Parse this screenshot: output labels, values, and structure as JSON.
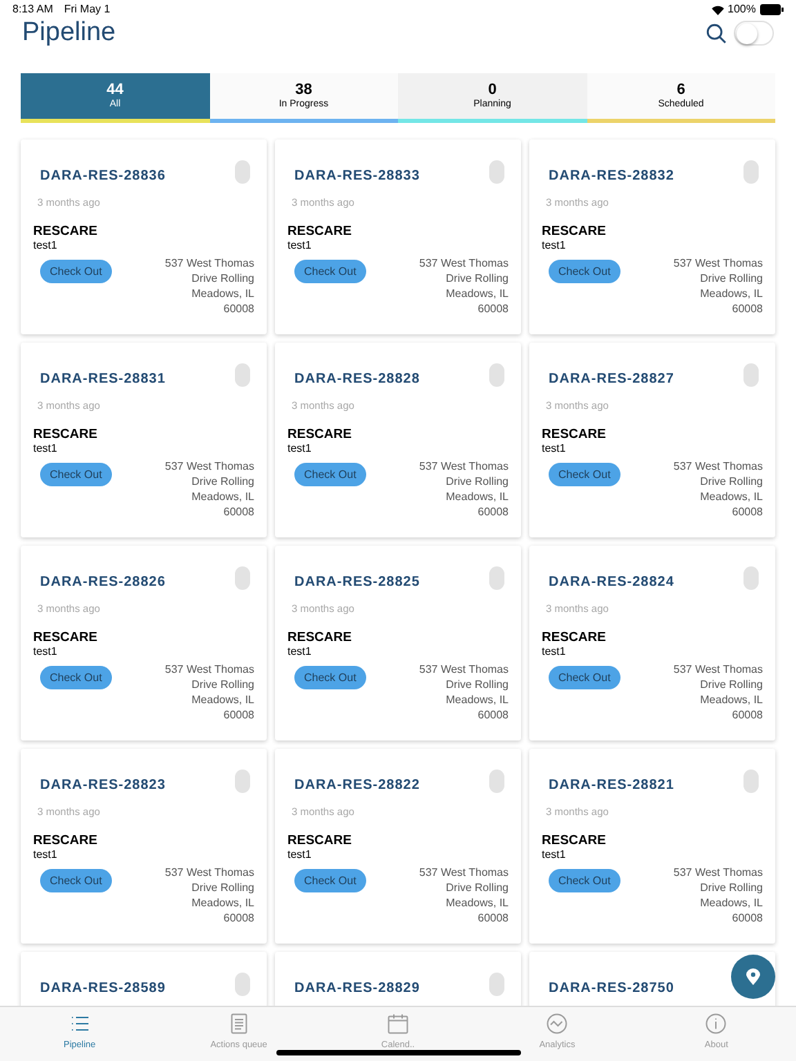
{
  "status_bar": {
    "time": "8:13 AM",
    "date": "Fri May 1",
    "battery": "100%"
  },
  "header": {
    "title": "Pipeline",
    "toggle": {
      "on": false
    }
  },
  "tabs": [
    {
      "count": "44",
      "label": "All",
      "selected": true,
      "color": "#e8e25a"
    },
    {
      "count": "38",
      "label": "In Progress",
      "selected": false,
      "color": "#6db3f0"
    },
    {
      "count": "0",
      "label": "Planning",
      "selected": false,
      "color": "#74e6e6"
    },
    {
      "count": "6",
      "label": "Scheduled",
      "selected": false,
      "color": "#ecd36a"
    }
  ],
  "cards": [
    {
      "id": "DARA-RES-28836",
      "time": "3 months ago",
      "org": "RESCARE",
      "name": "test1",
      "button": "Check Out",
      "address": "537 West Thomas Drive Rolling Meadows, IL 60008"
    },
    {
      "id": "DARA-RES-28833",
      "time": "3 months ago",
      "org": "RESCARE",
      "name": "test1",
      "button": "Check Out",
      "address": "537 West Thomas Drive Rolling Meadows, IL 60008"
    },
    {
      "id": "DARA-RES-28832",
      "time": "3 months ago",
      "org": "RESCARE",
      "name": "test1",
      "button": "Check Out",
      "address": "537 West Thomas Drive Rolling Meadows, IL 60008"
    },
    {
      "id": "DARA-RES-28831",
      "time": "3 months ago",
      "org": "RESCARE",
      "name": "test1",
      "button": "Check Out",
      "address": "537 West Thomas Drive Rolling Meadows, IL 60008"
    },
    {
      "id": "DARA-RES-28828",
      "time": "3 months ago",
      "org": "RESCARE",
      "name": "test1",
      "button": "Check Out",
      "address": "537 West Thomas Drive Rolling Meadows, IL 60008"
    },
    {
      "id": "DARA-RES-28827",
      "time": "3 months ago",
      "org": "RESCARE",
      "name": "test1",
      "button": "Check Out",
      "address": "537 West Thomas Drive Rolling Meadows, IL 60008"
    },
    {
      "id": "DARA-RES-28826",
      "time": "3 months ago",
      "org": "RESCARE",
      "name": "test1",
      "button": "Check Out",
      "address": "537 West Thomas Drive Rolling Meadows, IL 60008"
    },
    {
      "id": "DARA-RES-28825",
      "time": "3 months ago",
      "org": "RESCARE",
      "name": "test1",
      "button": "Check Out",
      "address": "537 West Thomas Drive Rolling Meadows, IL 60008"
    },
    {
      "id": "DARA-RES-28824",
      "time": "3 months ago",
      "org": "RESCARE",
      "name": "test1",
      "button": "Check Out",
      "address": "537 West Thomas Drive Rolling Meadows, IL 60008"
    },
    {
      "id": "DARA-RES-28823",
      "time": "3 months ago",
      "org": "RESCARE",
      "name": "test1",
      "button": "Check Out",
      "address": "537 West Thomas Drive Rolling Meadows, IL 60008"
    },
    {
      "id": "DARA-RES-28822",
      "time": "3 months ago",
      "org": "RESCARE",
      "name": "test1",
      "button": "Check Out",
      "address": "537 West Thomas Drive Rolling Meadows, IL 60008"
    },
    {
      "id": "DARA-RES-28821",
      "time": "3 months ago",
      "org": "RESCARE",
      "name": "test1",
      "button": "Check Out",
      "address": "537 West Thomas Drive Rolling Meadows, IL 60008"
    },
    {
      "id": "DARA-RES-28589"
    },
    {
      "id": "DARA-RES-28829"
    },
    {
      "id": "DARA-RES-28750"
    }
  ],
  "bottom_tabs": [
    {
      "label": "Pipeline",
      "kind": "list",
      "selected": true
    },
    {
      "label": "Actions queue",
      "kind": "document",
      "selected": false
    },
    {
      "label": "Calend..",
      "kind": "calendar",
      "selected": false
    },
    {
      "label": "Analytics",
      "kind": "chart",
      "selected": false
    },
    {
      "label": "About",
      "kind": "info",
      "selected": false
    }
  ]
}
